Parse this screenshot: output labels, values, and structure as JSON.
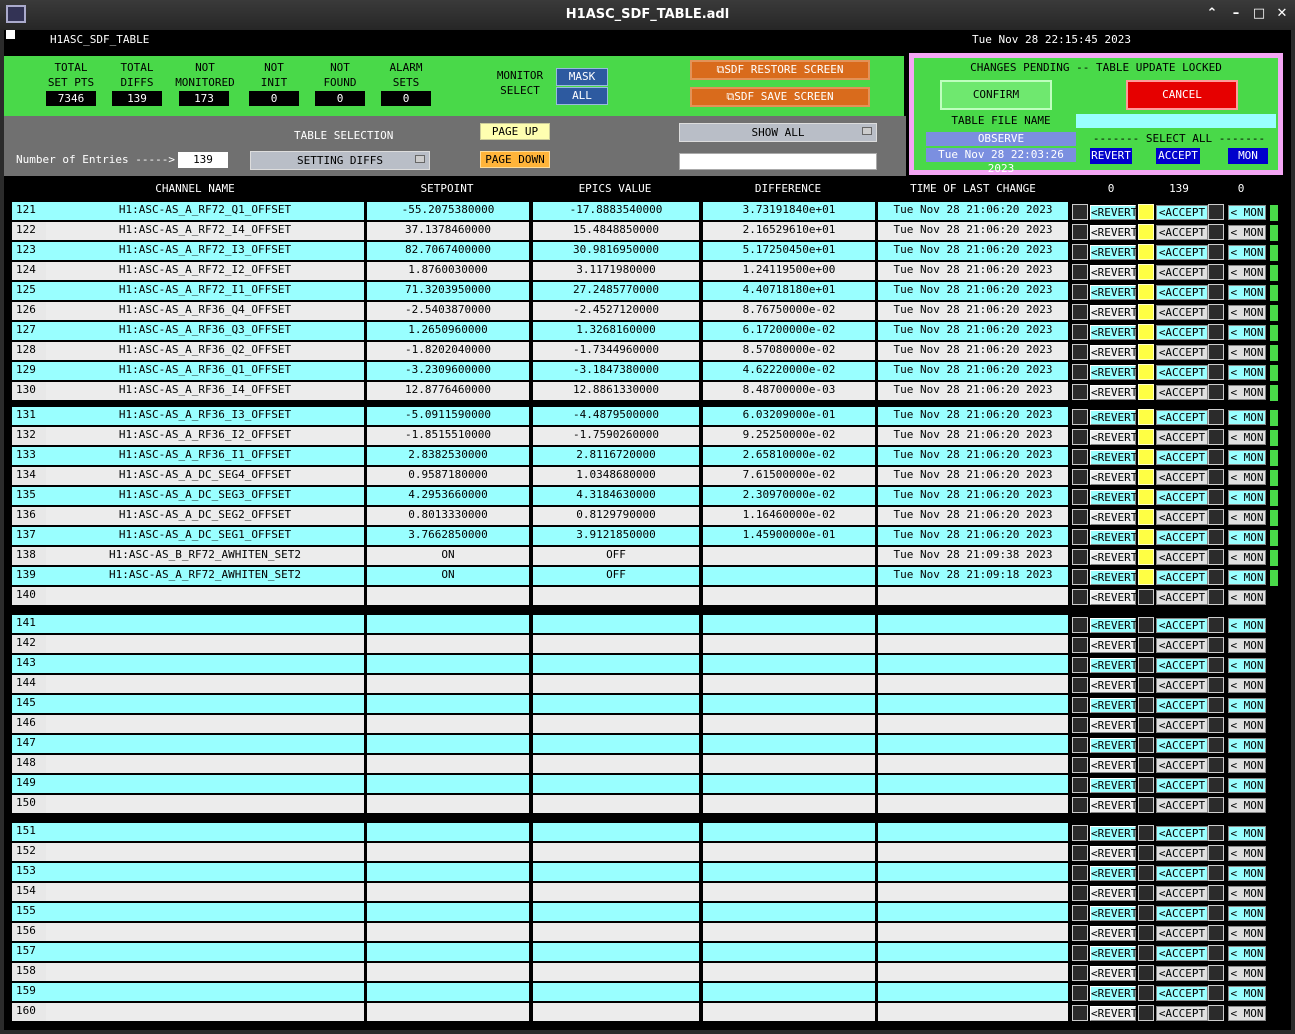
{
  "window": {
    "title": "H1ASC_SDF_TABLE.adl"
  },
  "header": {
    "name": "H1ASC_SDF_TABLE",
    "datetime": "Tue Nov 28 22:15:45 2023"
  },
  "stats": [
    {
      "label1": "TOTAL",
      "label2": "SET PTS",
      "value": "7346"
    },
    {
      "label1": "TOTAL",
      "label2": "DIFFS",
      "value": "139"
    },
    {
      "label1": "NOT",
      "label2": "MONITORED",
      "value": "173"
    },
    {
      "label1": "NOT",
      "label2": "INIT",
      "value": "0"
    },
    {
      "label1": "NOT",
      "label2": "FOUND",
      "value": "0"
    },
    {
      "label1": "ALARM",
      "label2": "SETS",
      "value": "0"
    }
  ],
  "monitor_select": {
    "label1": "MONITOR",
    "label2": "SELECT",
    "mask": "MASK",
    "all": "ALL"
  },
  "screens": {
    "restore": "SDF RESTORE SCREEN",
    "save": "SDF SAVE SCREEN"
  },
  "pending": {
    "title": "CHANGES PENDING -- TABLE UPDATE LOCKED",
    "confirm": "CONFIRM",
    "cancel": "CANCEL",
    "file_label": "TABLE FILE NAME",
    "file_mode": "OBSERVE",
    "file_time": "Tue Nov 28 22:03:26 2023",
    "select_all": "------- SELECT ALL -------",
    "revert": "REVERT",
    "accept": "ACCEPT",
    "mon": "MON"
  },
  "table_sel": {
    "label": "TABLE SELECTION",
    "entries_label": "Number of Entries ----->",
    "entries": "139",
    "selection": "SETTING DIFFS",
    "page_up": "PAGE UP",
    "page_down": "PAGE DOWN",
    "show": "SHOW ALL"
  },
  "columns": {
    "channel": "CHANNEL NAME",
    "setpoint": "SETPOINT",
    "epics": "EPICS VALUE",
    "diff": "DIFFERENCE",
    "time": "TIME OF LAST CHANGE",
    "c1": "0",
    "c2": "139",
    "c3": "0"
  },
  "buttons": {
    "revert": "<REVERT",
    "accept": "<ACCEPT",
    "mon": "< MON"
  },
  "rows": [
    {
      "n": "121",
      "ch": "H1:ASC-AS_A_RF72_Q1_OFFSET",
      "sp": "-55.2075380000",
      "ev": "-17.8883540000",
      "df": "3.73191840e+01",
      "t": "Tue Nov 28 21:06:20 2023"
    },
    {
      "n": "122",
      "ch": "H1:ASC-AS_A_RF72_I4_OFFSET",
      "sp": "37.1378460000",
      "ev": "15.4848850000",
      "df": "2.16529610e+01",
      "t": "Tue Nov 28 21:06:20 2023"
    },
    {
      "n": "123",
      "ch": "H1:ASC-AS_A_RF72_I3_OFFSET",
      "sp": "82.7067400000",
      "ev": "30.9816950000",
      "df": "5.17250450e+01",
      "t": "Tue Nov 28 21:06:20 2023"
    },
    {
      "n": "124",
      "ch": "H1:ASC-AS_A_RF72_I2_OFFSET",
      "sp": "1.8760030000",
      "ev": "3.1171980000",
      "df": "1.24119500e+00",
      "t": "Tue Nov 28 21:06:20 2023"
    },
    {
      "n": "125",
      "ch": "H1:ASC-AS_A_RF72_I1_OFFSET",
      "sp": "71.3203950000",
      "ev": "27.2485770000",
      "df": "4.40718180e+01",
      "t": "Tue Nov 28 21:06:20 2023"
    },
    {
      "n": "126",
      "ch": "H1:ASC-AS_A_RF36_Q4_OFFSET",
      "sp": "-2.5403870000",
      "ev": "-2.4527120000",
      "df": "8.76750000e-02",
      "t": "Tue Nov 28 21:06:20 2023"
    },
    {
      "n": "127",
      "ch": "H1:ASC-AS_A_RF36_Q3_OFFSET",
      "sp": "1.2650960000",
      "ev": "1.3268160000",
      "df": "6.17200000e-02",
      "t": "Tue Nov 28 21:06:20 2023"
    },
    {
      "n": "128",
      "ch": "H1:ASC-AS_A_RF36_Q2_OFFSET",
      "sp": "-1.8202040000",
      "ev": "-1.7344960000",
      "df": "8.57080000e-02",
      "t": "Tue Nov 28 21:06:20 2023"
    },
    {
      "n": "129",
      "ch": "H1:ASC-AS_A_RF36_Q1_OFFSET",
      "sp": "-3.2309600000",
      "ev": "-3.1847380000",
      "df": "4.62220000e-02",
      "t": "Tue Nov 28 21:06:20 2023"
    },
    {
      "n": "130",
      "ch": "H1:ASC-AS_A_RF36_I4_OFFSET",
      "sp": "12.8776460000",
      "ev": "12.8861330000",
      "df": "8.48700000e-03",
      "t": "Tue Nov 28 21:06:20 2023"
    },
    {
      "n": "131",
      "ch": "H1:ASC-AS_A_RF36_I3_OFFSET",
      "sp": "-5.0911590000",
      "ev": "-4.4879500000",
      "df": "6.03209000e-01",
      "t": "Tue Nov 28 21:06:20 2023"
    },
    {
      "n": "132",
      "ch": "H1:ASC-AS_A_RF36_I2_OFFSET",
      "sp": "-1.8515510000",
      "ev": "-1.7590260000",
      "df": "9.25250000e-02",
      "t": "Tue Nov 28 21:06:20 2023"
    },
    {
      "n": "133",
      "ch": "H1:ASC-AS_A_RF36_I1_OFFSET",
      "sp": "2.8382530000",
      "ev": "2.8116720000",
      "df": "2.65810000e-02",
      "t": "Tue Nov 28 21:06:20 2023"
    },
    {
      "n": "134",
      "ch": "H1:ASC-AS_A_DC_SEG4_OFFSET",
      "sp": "0.9587180000",
      "ev": "1.0348680000",
      "df": "7.61500000e-02",
      "t": "Tue Nov 28 21:06:20 2023"
    },
    {
      "n": "135",
      "ch": "H1:ASC-AS_A_DC_SEG3_OFFSET",
      "sp": "4.2953660000",
      "ev": "4.3184630000",
      "df": "2.30970000e-02",
      "t": "Tue Nov 28 21:06:20 2023"
    },
    {
      "n": "136",
      "ch": "H1:ASC-AS_A_DC_SEG2_OFFSET",
      "sp": "0.8013330000",
      "ev": "0.8129790000",
      "df": "1.16460000e-02",
      "t": "Tue Nov 28 21:06:20 2023"
    },
    {
      "n": "137",
      "ch": "H1:ASC-AS_A_DC_SEG1_OFFSET",
      "sp": "3.7662850000",
      "ev": "3.9121850000",
      "df": "1.45900000e-01",
      "t": "Tue Nov 28 21:06:20 2023"
    },
    {
      "n": "138",
      "ch": "H1:ASC-AS_B_RF72_AWHITEN_SET2",
      "sp": "ON",
      "ev": "OFF",
      "df": "",
      "t": "Tue Nov 28 21:09:38 2023"
    },
    {
      "n": "139",
      "ch": "H1:ASC-AS_A_RF72_AWHITEN_SET2",
      "sp": "ON",
      "ev": "OFF",
      "df": "",
      "t": "Tue Nov 28 21:09:18 2023"
    },
    {
      "n": "140",
      "ch": "",
      "sp": "",
      "ev": "",
      "df": "",
      "t": ""
    },
    {
      "n": "141",
      "ch": "",
      "sp": "",
      "ev": "",
      "df": "",
      "t": ""
    },
    {
      "n": "142",
      "ch": "",
      "sp": "",
      "ev": "",
      "df": "",
      "t": ""
    },
    {
      "n": "143",
      "ch": "",
      "sp": "",
      "ev": "",
      "df": "",
      "t": ""
    },
    {
      "n": "144",
      "ch": "",
      "sp": "",
      "ev": "",
      "df": "",
      "t": ""
    },
    {
      "n": "145",
      "ch": "",
      "sp": "",
      "ev": "",
      "df": "",
      "t": ""
    },
    {
      "n": "146",
      "ch": "",
      "sp": "",
      "ev": "",
      "df": "",
      "t": ""
    },
    {
      "n": "147",
      "ch": "",
      "sp": "",
      "ev": "",
      "df": "",
      "t": ""
    },
    {
      "n": "148",
      "ch": "",
      "sp": "",
      "ev": "",
      "df": "",
      "t": ""
    },
    {
      "n": "149",
      "ch": "",
      "sp": "",
      "ev": "",
      "df": "",
      "t": ""
    },
    {
      "n": "150",
      "ch": "",
      "sp": "",
      "ev": "",
      "df": "",
      "t": ""
    },
    {
      "n": "151",
      "ch": "",
      "sp": "",
      "ev": "",
      "df": "",
      "t": ""
    },
    {
      "n": "152",
      "ch": "",
      "sp": "",
      "ev": "",
      "df": "",
      "t": ""
    },
    {
      "n": "153",
      "ch": "",
      "sp": "",
      "ev": "",
      "df": "",
      "t": ""
    },
    {
      "n": "154",
      "ch": "",
      "sp": "",
      "ev": "",
      "df": "",
      "t": ""
    },
    {
      "n": "155",
      "ch": "",
      "sp": "",
      "ev": "",
      "df": "",
      "t": ""
    },
    {
      "n": "156",
      "ch": "",
      "sp": "",
      "ev": "",
      "df": "",
      "t": ""
    },
    {
      "n": "157",
      "ch": "",
      "sp": "",
      "ev": "",
      "df": "",
      "t": ""
    },
    {
      "n": "158",
      "ch": "",
      "sp": "",
      "ev": "",
      "df": "",
      "t": ""
    },
    {
      "n": "159",
      "ch": "",
      "sp": "",
      "ev": "",
      "df": "",
      "t": ""
    },
    {
      "n": "160",
      "ch": "",
      "sp": "",
      "ev": "",
      "df": "",
      "t": ""
    }
  ],
  "colors": {
    "green": "#49d949",
    "cyan": "#99ffff",
    "pink": "#f4a6f4",
    "orange": "#d96b1c",
    "red": "#e60000",
    "blue": "#2d5aa0",
    "navy": "#0000cc"
  }
}
